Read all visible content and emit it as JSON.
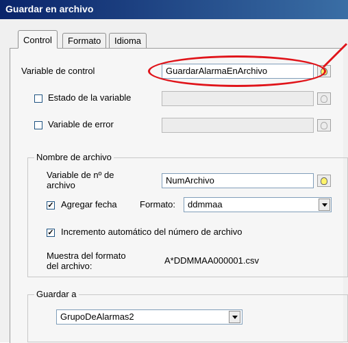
{
  "window": {
    "title": "Guardar en archivo"
  },
  "tabs": [
    {
      "label": "Control",
      "active": true
    },
    {
      "label": "Formato",
      "active": false
    },
    {
      "label": "Idioma",
      "active": false
    }
  ],
  "control": {
    "variable_control_label": "Variable de control",
    "variable_control_value": "GuardarAlarmaEnArchivo",
    "estado_label": "Estado de la variable",
    "estado_checked": false,
    "error_label": "Variable de error",
    "error_checked": false
  },
  "nombre_archivo": {
    "legend": "Nombre de archivo",
    "variable_nro_label_line1": "Variable de nº de",
    "variable_nro_label_line2": "archivo",
    "variable_nro_value": "NumArchivo",
    "agregar_fecha_label": "Agregar fecha",
    "agregar_fecha_checked": true,
    "formato_label": "Formato:",
    "formato_value": "ddmmaa",
    "incremento_label": "Incremento automático del número de archivo",
    "incremento_checked": true,
    "muestra_label_line1": "Muestra del formato",
    "muestra_label_line2": "del archivo:",
    "muestra_value": "A*DDMMAA000001.csv"
  },
  "guardar_a": {
    "legend": "Guardar a",
    "value": "GrupoDeAlarmas2"
  },
  "colors": {
    "highlight": "#e0141a",
    "titlebar": "#0a246a"
  }
}
